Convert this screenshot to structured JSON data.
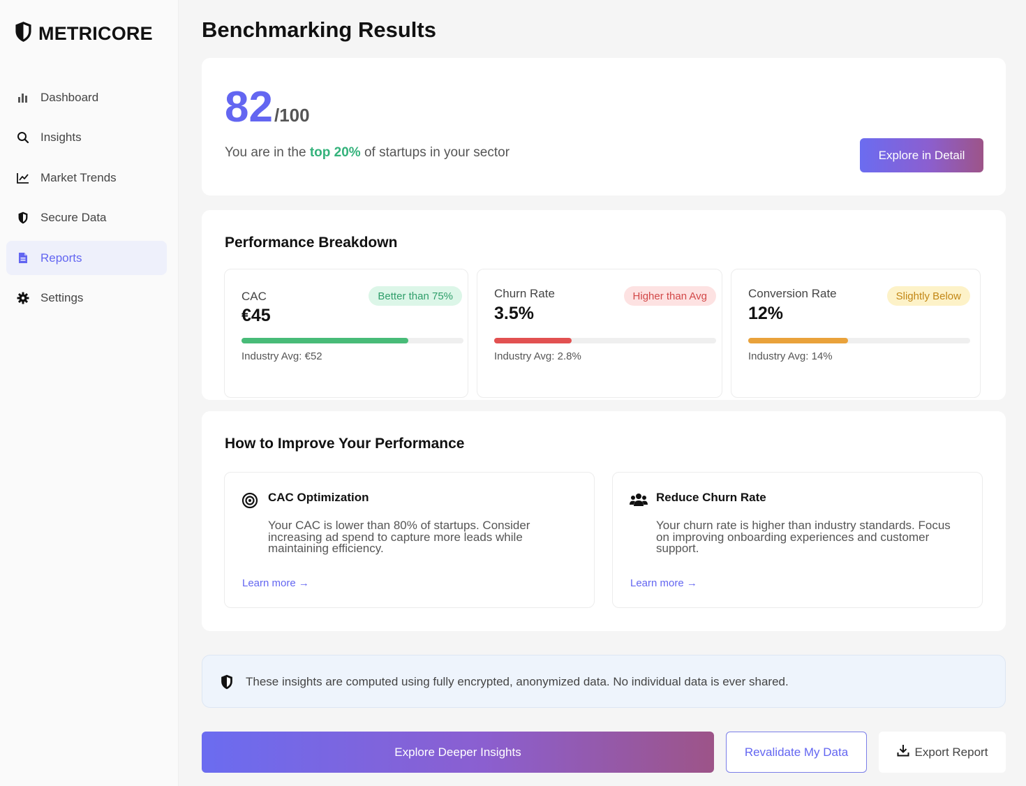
{
  "app": {
    "name": "METRICORE"
  },
  "nav": {
    "items": [
      {
        "label": "Dashboard",
        "icon": "bar-chart-icon"
      },
      {
        "label": "Insights",
        "icon": "search-icon"
      },
      {
        "label": "Market Trends",
        "icon": "trend-line-icon"
      },
      {
        "label": "Secure Data",
        "icon": "shield-icon"
      },
      {
        "label": "Reports",
        "icon": "document-icon",
        "active": true
      },
      {
        "label": "Settings",
        "icon": "gear-icon"
      }
    ]
  },
  "page": {
    "title": "Benchmarking Results"
  },
  "score": {
    "value": "82",
    "max": "/100",
    "subtitle_prefix": "You are in the",
    "subtitle_highlight": "top 20%",
    "subtitle_suffix": "of startups in your sector",
    "button_label": "Explore in Detail"
  },
  "performance": {
    "title": "Performance Breakdown",
    "metrics": [
      {
        "name": "CAC",
        "value": "€45",
        "badge": "Better than 75%",
        "fill_fraction": 0.75,
        "color": "#48bb78",
        "avg": "Industry Avg: €52"
      },
      {
        "name": "Churn Rate",
        "value": "3.5%",
        "badge": "Higher than Avg",
        "fill_fraction": 0.35,
        "color": "#e25151",
        "avg": "Industry Avg: 2.8%"
      },
      {
        "name": "Conversion Rate",
        "value": "12%",
        "badge": "Slightly Below",
        "fill_fraction": 0.45,
        "color": "#e9a23b",
        "avg": "Industry Avg: 14%"
      }
    ]
  },
  "improve": {
    "title": "How to Improve Your Performance",
    "tips": [
      {
        "title": "CAC Optimization",
        "icon": "target-icon",
        "body": "Your CAC is lower than 80% of startups. Consider increasing ad spend to capture more leads while maintaining efficiency.",
        "link": "Learn more →"
      },
      {
        "title": "Reduce Churn Rate",
        "icon": "users-icon",
        "body": "Your churn rate is higher than industry standards. Focus on improving onboarding experiences and customer support.",
        "link": "Learn more →"
      }
    ]
  },
  "privacy": {
    "text": "These insights are computed using fully encrypted, anonymized data. No individual data is ever shared."
  },
  "actions": {
    "deeper": "Explore Deeper Insights",
    "revalidate": "Revalidate My Data",
    "export": "Export Report"
  },
  "colors": {
    "accent": "#6366f1",
    "positive": "#34b27b",
    "negative": "#e25151",
    "warning": "#e9a23b"
  }
}
